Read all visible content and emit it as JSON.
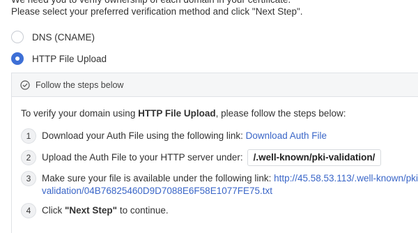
{
  "intro": {
    "line1": "We need you to verify ownership of each domain in your certificate.",
    "line2": "Please select your preferred verification method and click \"Next Step\"."
  },
  "methods": [
    {
      "label": "DNS (CNAME)",
      "selected": false
    },
    {
      "label": "HTTP File Upload",
      "selected": true
    }
  ],
  "panel": {
    "header_icon": "check-circle-icon",
    "title": "Follow the steps below",
    "intro_prefix": "To verify your domain using ",
    "intro_method": "HTTP File Upload",
    "intro_suffix": ", please follow the steps below:"
  },
  "steps": {
    "s1": {
      "num": "1",
      "text": "Download your Auth File using the following link: ",
      "link": "Download Auth File"
    },
    "s2": {
      "num": "2",
      "text": "Upload the Auth File to your HTTP server under:",
      "path": "/.well-known/pki-validation/"
    },
    "s3": {
      "num": "3",
      "text": "Make sure your file is available under the following link: ",
      "link_part1": "http://45.58.53.113/.well-known/pki-",
      "link_part2": "validation/04B76825460D9D7088E6F58E1077FE75.txt"
    },
    "s4": {
      "num": "4",
      "text_prefix": "Click ",
      "text_bold": "\"Next Step\"",
      "text_suffix": " to continue."
    }
  },
  "colors": {
    "accent": "#3d6fd6",
    "link": "#3a66c8",
    "header_bg": "#f5f6f7"
  }
}
